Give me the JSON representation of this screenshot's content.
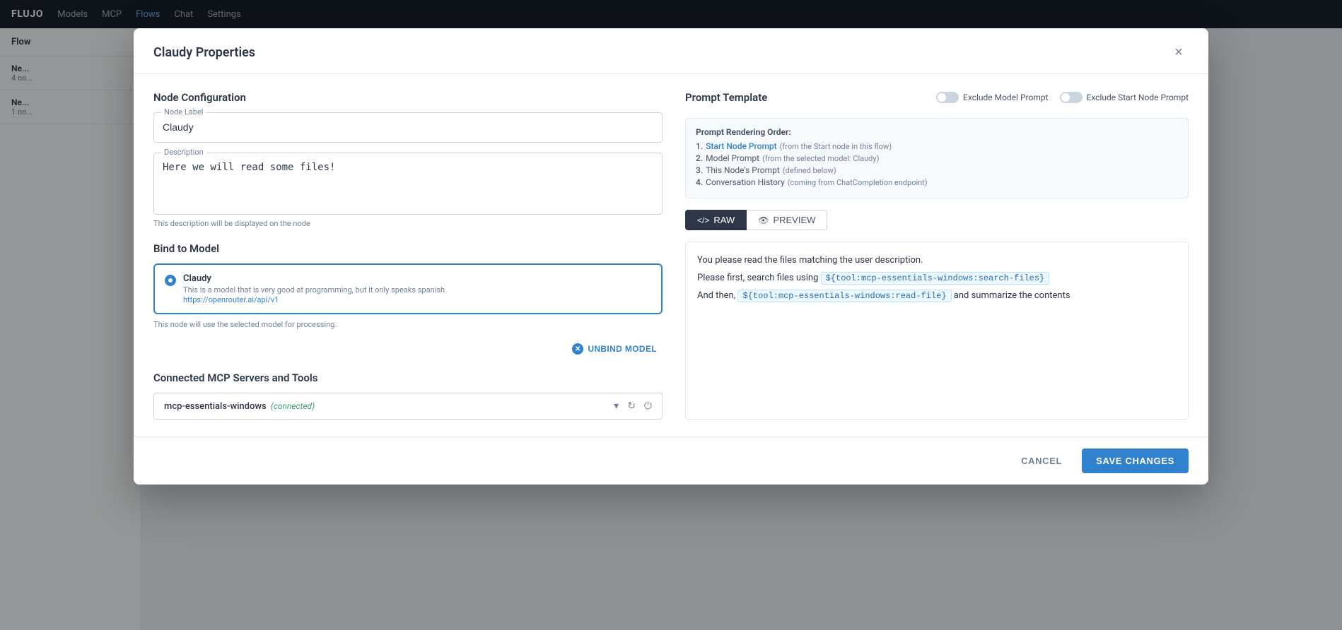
{
  "app": {
    "logo": "FLUJO",
    "nav": [
      "Models",
      "MCP",
      "Flows",
      "Chat",
      "Settings"
    ],
    "active_nav": "Flows"
  },
  "flow_panel": {
    "header": "Flow",
    "items": [
      {
        "title": "Ne...",
        "sub": "4 no..."
      },
      {
        "title": "Ne...",
        "sub": "1 no..."
      }
    ]
  },
  "modal": {
    "title": "Claudy Properties",
    "close_label": "×"
  },
  "left": {
    "section_title": "Node Configuration",
    "node_label_field": "Node Label",
    "node_label_value": "Claudy",
    "description_field": "Description",
    "description_value": "Here we will read some files!",
    "description_hint": "This description will be displayed on the node",
    "bind_to_model_title": "Bind to Model",
    "model": {
      "name": "Claudy",
      "desc": "This is a model that is very good at programming, but it only speaks spanish",
      "url": "https://openrouter.ai/api/v1"
    },
    "model_hint": "This node will use the selected model for processing.",
    "unbind_label": "UNBIND MODEL",
    "mcp_title": "Connected MCP Servers and Tools",
    "mcp_server": {
      "name": "mcp-essentials-windows",
      "status": "(connected)"
    }
  },
  "right": {
    "section_title": "Prompt Template",
    "toggle1": "Exclude Model Prompt",
    "toggle2": "Exclude Start Node Prompt",
    "prompt_order_title": "Prompt Rendering Order:",
    "prompt_order_items": [
      {
        "num": "1.",
        "link": "Start Node Prompt",
        "sub": "(from the Start node in this flow)"
      },
      {
        "num": "2.",
        "label": "Model Prompt",
        "sub": "(from the selected model: Claudy)"
      },
      {
        "num": "3.",
        "label": "This Node's Prompt",
        "sub": "(defined below)"
      },
      {
        "num": "4.",
        "label": "Conversation History",
        "sub": "(coming from ChatCompletion endpoint)"
      }
    ],
    "tab_raw": "RAW",
    "tab_preview": "PREVIEW",
    "prompt_line1": "You please read the files matching the user description.",
    "prompt_line2_pre": "Please first, search files using ",
    "prompt_line2_tag": "${tool:mcp-essentials-windows:search-files}",
    "prompt_line3_pre": "And then, ",
    "prompt_line3_tag": "${tool:mcp-essentials-windows:read-file}",
    "prompt_line3_post": " and summarize the contents"
  },
  "footer": {
    "cancel_label": "CANCEL",
    "save_label": "SAVE CHANGES"
  }
}
